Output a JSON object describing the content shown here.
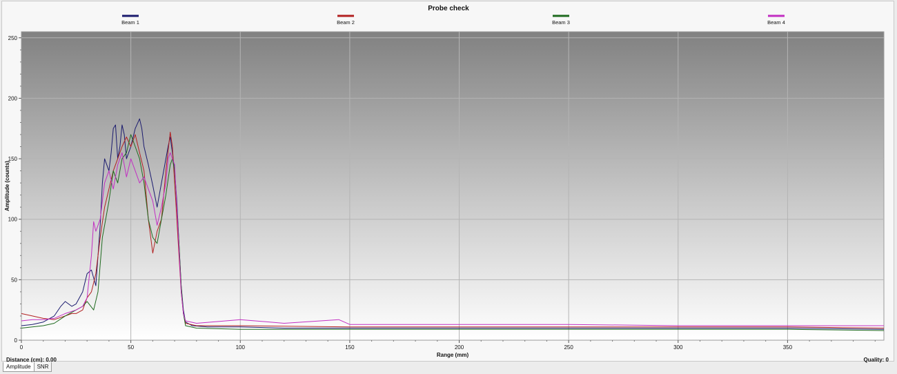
{
  "chart_data": {
    "type": "line",
    "title": "Probe check",
    "xlabel": "Range (mm)",
    "ylabel": "Amplitude (counts)",
    "xlim": [
      0,
      394
    ],
    "ylim": [
      0,
      255
    ],
    "x_ticks": [
      0,
      50,
      100,
      150,
      200,
      250,
      300,
      350
    ],
    "y_ticks": [
      0,
      50,
      100,
      150,
      200,
      250
    ],
    "grid": true,
    "legend_position": "top",
    "background": "vertical gradient dark gray to white",
    "series": [
      {
        "name": "Beam 1",
        "color": "#1a1a6e",
        "points": [
          [
            0,
            12
          ],
          [
            5,
            13
          ],
          [
            10,
            15
          ],
          [
            15,
            20
          ],
          [
            18,
            28
          ],
          [
            20,
            32
          ],
          [
            23,
            28
          ],
          [
            25,
            30
          ],
          [
            28,
            40
          ],
          [
            30,
            55
          ],
          [
            32,
            58
          ],
          [
            34,
            45
          ],
          [
            36,
            95
          ],
          [
            37,
            130
          ],
          [
            38,
            150
          ],
          [
            40,
            140
          ],
          [
            41,
            155
          ],
          [
            42,
            175
          ],
          [
            43,
            178
          ],
          [
            44,
            150
          ],
          [
            45,
            160
          ],
          [
            46,
            178
          ],
          [
            47,
            170
          ],
          [
            48,
            150
          ],
          [
            50,
            160
          ],
          [
            52,
            175
          ],
          [
            54,
            183
          ],
          [
            55,
            175
          ],
          [
            56,
            160
          ],
          [
            58,
            145
          ],
          [
            60,
            128
          ],
          [
            62,
            110
          ],
          [
            64,
            130
          ],
          [
            66,
            150
          ],
          [
            67,
            160
          ],
          [
            68,
            168
          ],
          [
            69,
            155
          ],
          [
            70,
            140
          ],
          [
            71,
            115
          ],
          [
            72,
            80
          ],
          [
            73,
            45
          ],
          [
            74,
            25
          ],
          [
            75,
            15
          ],
          [
            78,
            12
          ],
          [
            85,
            11
          ],
          [
            100,
            11
          ],
          [
            120,
            10
          ],
          [
            150,
            10
          ],
          [
            200,
            10
          ],
          [
            250,
            10
          ],
          [
            300,
            10
          ],
          [
            350,
            10
          ],
          [
            394,
            9
          ]
        ]
      },
      {
        "name": "Beam 2",
        "color": "#b22020",
        "points": [
          [
            0,
            22
          ],
          [
            5,
            20
          ],
          [
            10,
            18
          ],
          [
            15,
            17
          ],
          [
            20,
            20
          ],
          [
            23,
            22
          ],
          [
            25,
            22
          ],
          [
            28,
            25
          ],
          [
            30,
            35
          ],
          [
            32,
            40
          ],
          [
            34,
            55
          ],
          [
            36,
            85
          ],
          [
            38,
            110
          ],
          [
            40,
            125
          ],
          [
            42,
            140
          ],
          [
            44,
            150
          ],
          [
            46,
            160
          ],
          [
            48,
            168
          ],
          [
            50,
            160
          ],
          [
            52,
            170
          ],
          [
            54,
            155
          ],
          [
            56,
            140
          ],
          [
            58,
            100
          ],
          [
            60,
            72
          ],
          [
            62,
            90
          ],
          [
            64,
            100
          ],
          [
            66,
            140
          ],
          [
            68,
            172
          ],
          [
            69,
            160
          ],
          [
            70,
            130
          ],
          [
            71,
            100
          ],
          [
            72,
            70
          ],
          [
            73,
            40
          ],
          [
            74,
            22
          ],
          [
            75,
            14
          ],
          [
            80,
            12
          ],
          [
            100,
            12
          ],
          [
            150,
            11
          ],
          [
            200,
            11
          ],
          [
            250,
            11
          ],
          [
            300,
            11
          ],
          [
            350,
            11
          ],
          [
            394,
            10
          ]
        ]
      },
      {
        "name": "Beam 3",
        "color": "#1e6a1e",
        "points": [
          [
            0,
            10
          ],
          [
            5,
            11
          ],
          [
            10,
            12
          ],
          [
            15,
            14
          ],
          [
            20,
            20
          ],
          [
            25,
            25
          ],
          [
            28,
            28
          ],
          [
            30,
            32
          ],
          [
            33,
            25
          ],
          [
            35,
            40
          ],
          [
            37,
            85
          ],
          [
            38,
            95
          ],
          [
            40,
            115
          ],
          [
            42,
            140
          ],
          [
            44,
            130
          ],
          [
            46,
            150
          ],
          [
            48,
            155
          ],
          [
            50,
            170
          ],
          [
            52,
            160
          ],
          [
            54,
            150
          ],
          [
            56,
            130
          ],
          [
            58,
            100
          ],
          [
            60,
            85
          ],
          [
            62,
            80
          ],
          [
            64,
            100
          ],
          [
            66,
            120
          ],
          [
            68,
            145
          ],
          [
            69,
            150
          ],
          [
            70,
            140
          ],
          [
            71,
            110
          ],
          [
            72,
            80
          ],
          [
            73,
            45
          ],
          [
            74,
            22
          ],
          [
            75,
            12
          ],
          [
            80,
            10
          ],
          [
            100,
            9
          ],
          [
            150,
            9
          ],
          [
            200,
            9
          ],
          [
            250,
            9
          ],
          [
            300,
            9
          ],
          [
            350,
            9
          ],
          [
            394,
            8
          ]
        ]
      },
      {
        "name": "Beam 4",
        "color": "#c22ec2",
        "points": [
          [
            0,
            16
          ],
          [
            5,
            17
          ],
          [
            10,
            17
          ],
          [
            15,
            18
          ],
          [
            20,
            22
          ],
          [
            25,
            25
          ],
          [
            28,
            28
          ],
          [
            30,
            35
          ],
          [
            32,
            70
          ],
          [
            33,
            98
          ],
          [
            34,
            90
          ],
          [
            36,
            100
          ],
          [
            38,
            130
          ],
          [
            40,
            140
          ],
          [
            42,
            125
          ],
          [
            44,
            145
          ],
          [
            46,
            155
          ],
          [
            48,
            135
          ],
          [
            50,
            150
          ],
          [
            52,
            140
          ],
          [
            54,
            130
          ],
          [
            56,
            135
          ],
          [
            58,
            125
          ],
          [
            60,
            115
          ],
          [
            62,
            95
          ],
          [
            64,
            110
          ],
          [
            66,
            130
          ],
          [
            67,
            150
          ],
          [
            68,
            155
          ],
          [
            70,
            145
          ],
          [
            71,
            110
          ],
          [
            72,
            75
          ],
          [
            73,
            40
          ],
          [
            74,
            22
          ],
          [
            75,
            16
          ],
          [
            80,
            14
          ],
          [
            100,
            17
          ],
          [
            120,
            14
          ],
          [
            145,
            17
          ],
          [
            150,
            13
          ],
          [
            200,
            13
          ],
          [
            250,
            13
          ],
          [
            300,
            12
          ],
          [
            350,
            12
          ],
          [
            394,
            12
          ]
        ]
      }
    ]
  },
  "status": {
    "distance_label": "Distance (cm): 0.00",
    "quality_label": "Quality: 0"
  },
  "tabs": [
    {
      "label": "Amplitude"
    },
    {
      "label": "SNR"
    }
  ]
}
